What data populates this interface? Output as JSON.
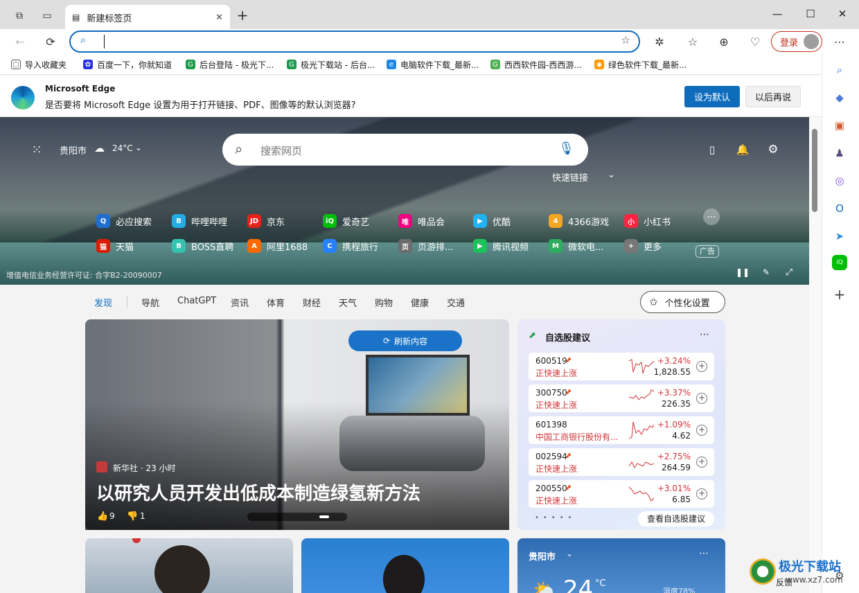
{
  "browser": {
    "tab_title": "新建标签页",
    "login_label": "登录",
    "address_value": ""
  },
  "bookmarks": [
    {
      "label": "导入收藏夹",
      "icon": "import-icon",
      "color": "#555555"
    },
    {
      "label": "百度一下，你就知道",
      "icon": "baidu-icon",
      "color": "#2932e1"
    },
    {
      "label": "后台登陆 - 极光下...",
      "icon": "jg-icon",
      "color": "#1a9a4a"
    },
    {
      "label": "极光下载站 - 后台...",
      "icon": "jg-icon",
      "color": "#1a9a4a"
    },
    {
      "label": "电脑软件下载_最新...",
      "icon": "pc-icon",
      "color": "#1e88e5"
    },
    {
      "label": "西西软件园-西西游...",
      "icon": "xixi-icon",
      "color": "#4caf50"
    },
    {
      "label": "绿色软件下载_最新...",
      "icon": "green-icon",
      "color": "#ff9800"
    }
  ],
  "infobar": {
    "title": "Microsoft Edge",
    "message": "是否要将 Microsoft Edge 设置为用于打开链接、PDF、图像等的默认浏览器?",
    "primary": "设为默认",
    "secondary": "以后再说"
  },
  "hero": {
    "city": "贵阳市",
    "temp": "24°C",
    "search_placeholder": "搜索网页",
    "quick_links_label": "快速链接",
    "license": "增值电信业务经营许可证: 合字B2-20090007",
    "ad_label": "广告",
    "tiles_row1": [
      {
        "label": "必应搜索",
        "color": "#1f6fd1",
        "glyph": "Q"
      },
      {
        "label": "哔哩哔哩",
        "color": "#23ade5",
        "glyph": "B"
      },
      {
        "label": "京东",
        "color": "#e1251b",
        "glyph": "JD"
      },
      {
        "label": "爱奇艺",
        "color": "#00be06",
        "glyph": "iQ"
      },
      {
        "label": "唯品会",
        "color": "#f10180",
        "glyph": "唯"
      },
      {
        "label": "优酷",
        "color": "#1fb3f6",
        "glyph": "▶"
      },
      {
        "label": "4366游戏",
        "color": "#f5a623",
        "glyph": "4"
      },
      {
        "label": "小红书",
        "color": "#ff2442",
        "glyph": "小"
      }
    ],
    "tiles_row2": [
      {
        "label": "天猫",
        "color": "#d81e06",
        "glyph": "猫"
      },
      {
        "label": "BOSS直聘",
        "color": "#35c3b1",
        "glyph": "B"
      },
      {
        "label": "阿里1688",
        "color": "#ff6a00",
        "glyph": "A"
      },
      {
        "label": "携程旅行",
        "color": "#2681ff",
        "glyph": "C"
      },
      {
        "label": "页游排...",
        "color": "#6c6c6c",
        "glyph": "页"
      },
      {
        "label": "腾讯视频",
        "color": "#1cc35b",
        "glyph": "▶"
      },
      {
        "label": "微软电...",
        "color": "#2dad5e",
        "glyph": "M"
      },
      {
        "label": "更多",
        "color": "#777777",
        "glyph": "+"
      }
    ]
  },
  "nav": {
    "items": [
      "发现",
      "导航",
      "ChatGPT",
      "资讯",
      "体育",
      "财经",
      "天气",
      "购物",
      "健康",
      "交通"
    ],
    "personalize": "个性化设置"
  },
  "feature": {
    "refresh": "刷新内容",
    "source": "新华社 · 23 小时",
    "headline": "以研究人员开发出低成本制造绿氢新方法",
    "likes": "9",
    "dislikes": "1"
  },
  "stocks": {
    "title": "自选股建议",
    "view_all": "查看自选股建议",
    "items": [
      {
        "code": "600519",
        "sub": "正快速上涨",
        "pct": "+3.24%",
        "price": "1,828.55"
      },
      {
        "code": "300750",
        "sub": "正快速上涨",
        "pct": "+3.37%",
        "price": "226.35"
      },
      {
        "code": "601398",
        "sub": "中国工商银行股份有...",
        "pct": "+1.09%",
        "price": "4.62"
      },
      {
        "code": "002594",
        "sub": "正快速上涨",
        "pct": "+2.75%",
        "price": "264.59"
      },
      {
        "code": "200550",
        "sub": "正快速上涨",
        "pct": "+3.01%",
        "price": "6.85"
      }
    ]
  },
  "weather": {
    "city": "贵阳市",
    "temp": "24",
    "unit": "°C",
    "humidity": "湿度78%",
    "feedback": "反馈"
  },
  "watermark": {
    "title": "极光下载站",
    "url": "www.xz7.com"
  }
}
